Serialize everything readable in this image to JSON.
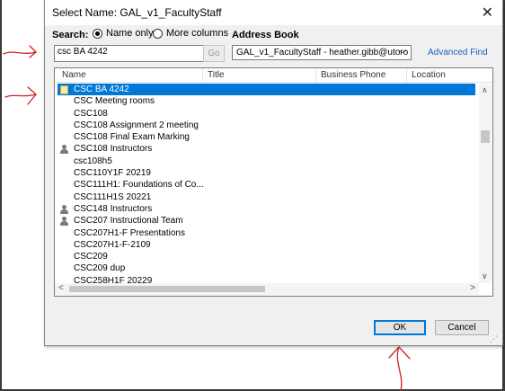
{
  "dialog": {
    "title": "Select Name: GAL_v1_FacultyStaff",
    "close_glyph": "✕"
  },
  "search": {
    "label": "Search:",
    "value": "csc BA 4242",
    "go_label": "Go",
    "options": [
      {
        "label": "Name only",
        "checked": true
      },
      {
        "label": "More columns",
        "checked": false
      }
    ]
  },
  "address_book": {
    "label": "Address Book",
    "selected": "GAL_v1_FacultyStaff - heather.gibb@utoro",
    "advanced_find": "Advanced Find"
  },
  "columns": [
    "Name",
    "Title",
    "Business Phone",
    "Location"
  ],
  "rows": [
    {
      "name": "CSC BA 4242",
      "icon": "contact-card-icon",
      "selected": true
    },
    {
      "name": "CSC Meeting rooms",
      "icon": "",
      "selected": false
    },
    {
      "name": "CSC108",
      "icon": "",
      "selected": false
    },
    {
      "name": "CSC108 Assignment 2 meeting",
      "icon": "",
      "selected": false
    },
    {
      "name": "CSC108 Final Exam Marking",
      "icon": "",
      "selected": false
    },
    {
      "name": "CSC108 Instructors",
      "icon": "group-icon",
      "selected": false
    },
    {
      "name": "csc108h5",
      "icon": "",
      "selected": false
    },
    {
      "name": "CSC110Y1F 20219",
      "icon": "",
      "selected": false
    },
    {
      "name": "CSC111H1: Foundations of Co...",
      "icon": "",
      "selected": false
    },
    {
      "name": "CSC111H1S 20221",
      "icon": "",
      "selected": false
    },
    {
      "name": "CSC148 Instructors",
      "icon": "group-icon",
      "selected": false
    },
    {
      "name": "CSC207 Instructional Team",
      "icon": "group-icon",
      "selected": false
    },
    {
      "name": "CSC207H1-F Presentations",
      "icon": "",
      "selected": false
    },
    {
      "name": "CSC207H1-F-2109",
      "icon": "",
      "selected": false
    },
    {
      "name": "CSC209",
      "icon": "",
      "selected": false
    },
    {
      "name": "CSC209 dup",
      "icon": "",
      "selected": false
    },
    {
      "name": "CSC258H1F 20229",
      "icon": "",
      "selected": false
    }
  ],
  "buttons": {
    "ok": "OK",
    "cancel": "Cancel"
  },
  "colors": {
    "selection": "#0078d7",
    "annotation_red": "#cc2222",
    "link": "#1f5fbf"
  },
  "annotations": [
    "arrow-to-search-field",
    "arrow-to-selected-row",
    "arrow-to-ok-button"
  ]
}
